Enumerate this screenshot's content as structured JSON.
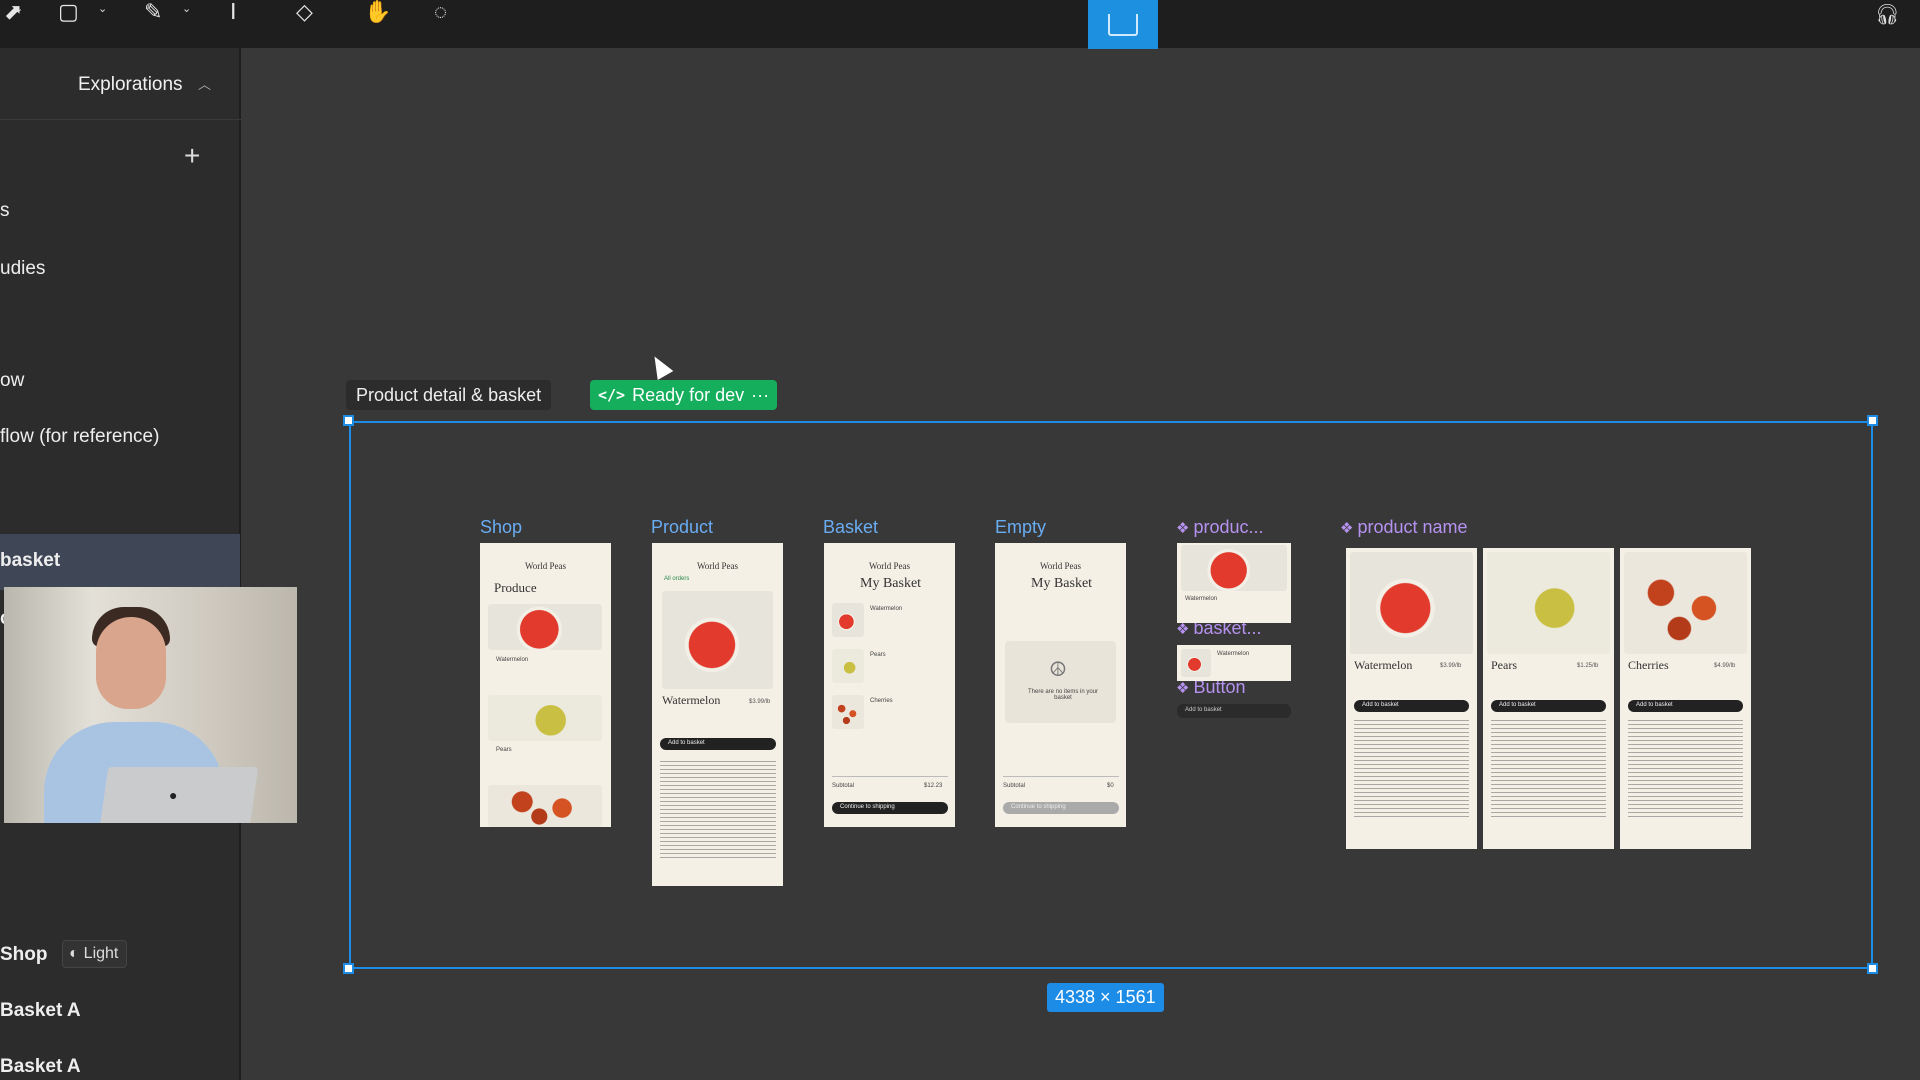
{
  "toolbar": {
    "tools": [
      "move-icon",
      "frame-icon",
      "pen-icon",
      "text-icon",
      "resources-icon",
      "hand-icon",
      "comment-icon"
    ],
    "dev_mode_active": true
  },
  "sidebar": {
    "section_title": "Explorations",
    "pages": [
      {
        "label": "s"
      },
      {
        "label": "udies"
      },
      {
        "label": "ow"
      },
      {
        "label": "flow (for reference)"
      },
      {
        "label": "basket",
        "selected": true
      },
      {
        "label": "c"
      }
    ],
    "frames": [
      {
        "label": "Shop",
        "badge": "Light"
      },
      {
        "label": "Basket A"
      },
      {
        "label": "Basket A"
      }
    ]
  },
  "canvas": {
    "section_name": "Product detail & basket",
    "status_badge": "Ready for dev",
    "status_more": "···",
    "dimensions": "4338 × 1561",
    "frames": [
      {
        "title": "Shop"
      },
      {
        "title": "Product"
      },
      {
        "title": "Basket"
      },
      {
        "title": "Empty"
      }
    ],
    "components": [
      {
        "title": "produc..."
      },
      {
        "title": "basket..."
      },
      {
        "title": "Button"
      },
      {
        "title": "product name"
      }
    ],
    "screens": {
      "brand": "World Peas",
      "shop_heading": "Produce",
      "basket_heading": "My Basket",
      "product_name": "Watermelon",
      "product_price": "$3.99/lb",
      "add_to_basket": "Add to basket",
      "all_orders": "All orders",
      "subtotal_label": "Subtotal",
      "subtotal_value": "$12.23",
      "subtotal_empty": "$0",
      "continue": "Continue to shipping",
      "empty_message": "There are no items in your basket",
      "basket_items": [
        "Watermelon",
        "Pears",
        "Cherries"
      ],
      "shop_items": [
        "Watermelon",
        "Pears"
      ],
      "variants": [
        {
          "name": "Watermelon",
          "price": "$3.99/lb"
        },
        {
          "name": "Pears",
          "price": "$1.25/lb"
        },
        {
          "name": "Cherries",
          "price": "$4.99/lb"
        }
      ]
    }
  }
}
